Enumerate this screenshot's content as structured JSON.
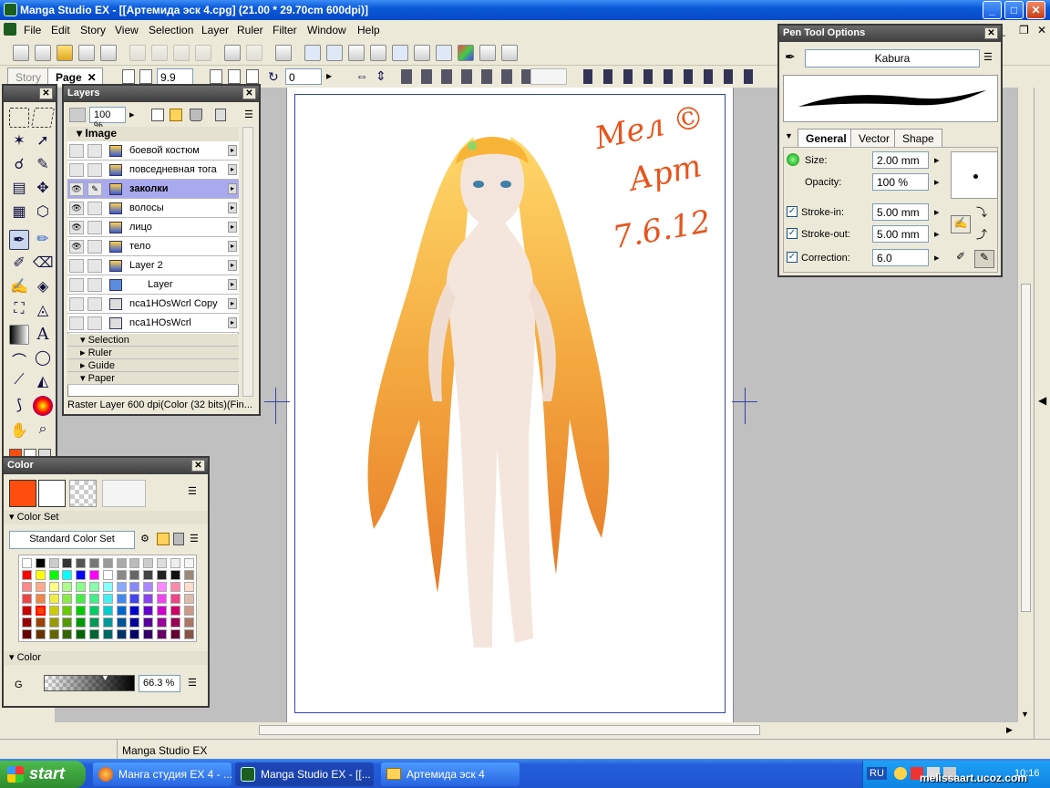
{
  "window": {
    "title": "Manga Studio EX - [[Артемида эск 4.cpg] (21.00 * 29.70cm 600dpi)]",
    "minimize": "_",
    "maximize": "□",
    "close": "✕"
  },
  "menu": [
    "File",
    "Edit",
    "Story",
    "View",
    "Selection",
    "Layer",
    "Ruler",
    "Filter",
    "Window",
    "Help"
  ],
  "tabs": {
    "story": "Story",
    "page": "Page",
    "page_close": "✕"
  },
  "toolbar2": {
    "zoom_value": "9.9",
    "rotation_value": "0"
  },
  "layers_panel": {
    "title": "Layers",
    "zoom": "100 %",
    "group": "Image",
    "layers": [
      {
        "name": "боевой костюм",
        "visible": false,
        "selected": false
      },
      {
        "name": "повседневная тога",
        "visible": false,
        "selected": false
      },
      {
        "name": "заколки",
        "visible": true,
        "selected": true
      },
      {
        "name": "волосы",
        "visible": true,
        "selected": false
      },
      {
        "name": "лицо",
        "visible": true,
        "selected": false
      },
      {
        "name": "тело",
        "visible": true,
        "selected": false
      },
      {
        "name": "Layer 2",
        "visible": false,
        "selected": false
      },
      {
        "name": "Layer",
        "visible": false,
        "selected": false
      },
      {
        "name": "nca1HOsWcrl Copy",
        "visible": false,
        "selected": false
      },
      {
        "name": "nca1HOsWcrl",
        "visible": false,
        "selected": false
      }
    ],
    "sections": [
      "Selection",
      "Ruler",
      "Guide",
      "Paper"
    ],
    "status": "Raster Layer 600 dpi(Color (32 bits)(Fin..."
  },
  "pen_panel": {
    "title": "Pen Tool Options",
    "brush": "Kabura",
    "tabs": [
      "General",
      "Vector",
      "Shape"
    ],
    "size_label": "Size:",
    "size": "2.00 mm",
    "opacity_label": "Opacity:",
    "opacity": "100 %",
    "stroke_in_label": "Stroke-in:",
    "stroke_in": "5.00 mm",
    "stroke_out_label": "Stroke-out:",
    "stroke_out": "5.00 mm",
    "correction_label": "Correction:",
    "correction": "6.0"
  },
  "color_panel": {
    "title": "Color",
    "main_color": "#ff4d0f",
    "colorset_header": "Color Set",
    "colorset_name": "Standard Color Set",
    "color_header": "Color",
    "channel": "G",
    "value": "66.3 %"
  },
  "statusbar": {
    "text": "Manga Studio EX"
  },
  "taskbar": {
    "start": "start",
    "tasks": [
      "Манга студия EX 4 - ...",
      "Manga Studio EX - [[...",
      "Артемида эск 4"
    ],
    "lang": "RU",
    "clock": "10:16",
    "watermark": "melissaart.ucoz.com"
  },
  "artwork": {
    "signature": "Мел ©",
    "signature2": "Арт",
    "date": "7.6.12"
  },
  "colors": {
    "xp_blue": "#245edc",
    "panel_bg": "#ece9d8",
    "selected_layer": "#a9a9ef",
    "hair": "#f2a02a"
  }
}
